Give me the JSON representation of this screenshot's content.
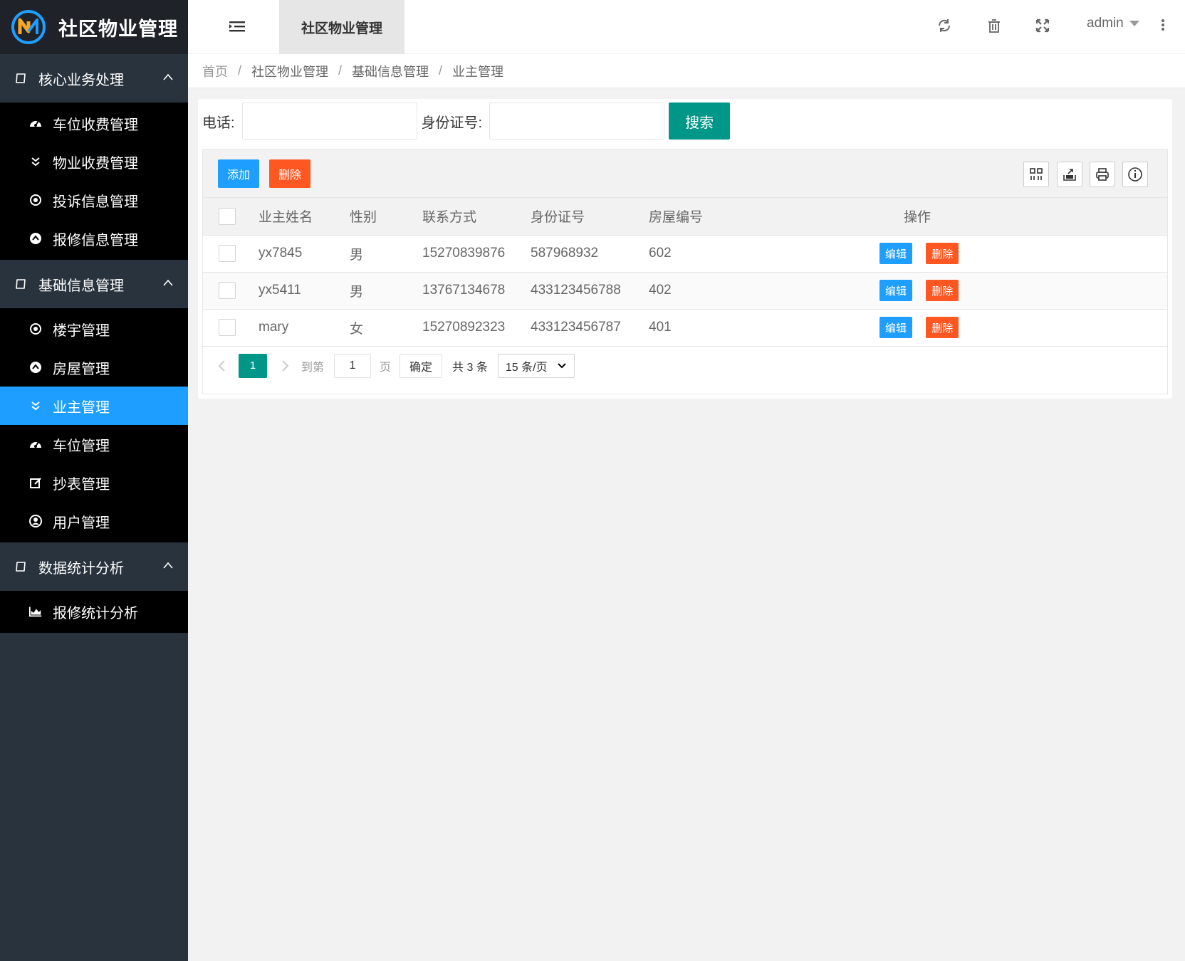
{
  "app": {
    "title": "社区物业管理"
  },
  "sidebar": {
    "groups": [
      {
        "label": "核心业务处理",
        "items": [
          {
            "label": "车位收费管理",
            "icon": "dashboard-icon"
          },
          {
            "label": "物业收费管理",
            "icon": "double-chevron-down-icon"
          },
          {
            "label": "投诉信息管理",
            "icon": "target-icon"
          },
          {
            "label": "报修信息管理",
            "icon": "circle-up-icon"
          }
        ]
      },
      {
        "label": "基础信息管理",
        "items": [
          {
            "label": "楼宇管理",
            "icon": "target-icon"
          },
          {
            "label": "房屋管理",
            "icon": "circle-up-icon"
          },
          {
            "label": "业主管理",
            "icon": "double-chevron-down-icon",
            "active": true
          },
          {
            "label": "车位管理",
            "icon": "dashboard-icon"
          },
          {
            "label": "抄表管理",
            "icon": "edit-icon"
          },
          {
            "label": "用户管理",
            "icon": "user-circle-icon"
          }
        ]
      },
      {
        "label": "数据统计分析",
        "items": [
          {
            "label": "报修统计分析",
            "icon": "area-chart-icon"
          }
        ]
      }
    ]
  },
  "header": {
    "tab": "社区物业管理",
    "user": "admin",
    "icons": [
      "refresh-icon",
      "trash-icon",
      "fullscreen-icon",
      "more-icon"
    ]
  },
  "breadcrumb": [
    "首页",
    "社区物业管理",
    "基础信息管理",
    "业主管理"
  ],
  "search": {
    "phone_label": "电话:",
    "phone_value": "",
    "idcard_label": "身份证号:",
    "idcard_value": "",
    "button": "搜索"
  },
  "toolbar": {
    "add": "添加",
    "delete": "删除"
  },
  "table": {
    "columns": [
      "业主姓名",
      "性别",
      "联系方式",
      "身份证号",
      "房屋编号",
      "操作"
    ],
    "rows": [
      [
        "yx7845",
        "男",
        "15270839876",
        "587968932",
        "602"
      ],
      [
        "yx5411",
        "男",
        "13767134678",
        "433123456788",
        "402"
      ],
      [
        "mary",
        "女",
        "15270892323",
        "433123456787",
        "401"
      ]
    ],
    "edit_label": "编辑",
    "delete_label": "删除"
  },
  "pager": {
    "current": "1",
    "goto_label": "到第",
    "goto_value": "1",
    "page_unit": "页",
    "confirm": "确定",
    "total": "共 3 条",
    "page_size": "15 条/页"
  },
  "colors": {
    "sidebar": "#28333e",
    "active": "#1e9fff",
    "primary": "#009688",
    "danger": "#ff5722"
  }
}
